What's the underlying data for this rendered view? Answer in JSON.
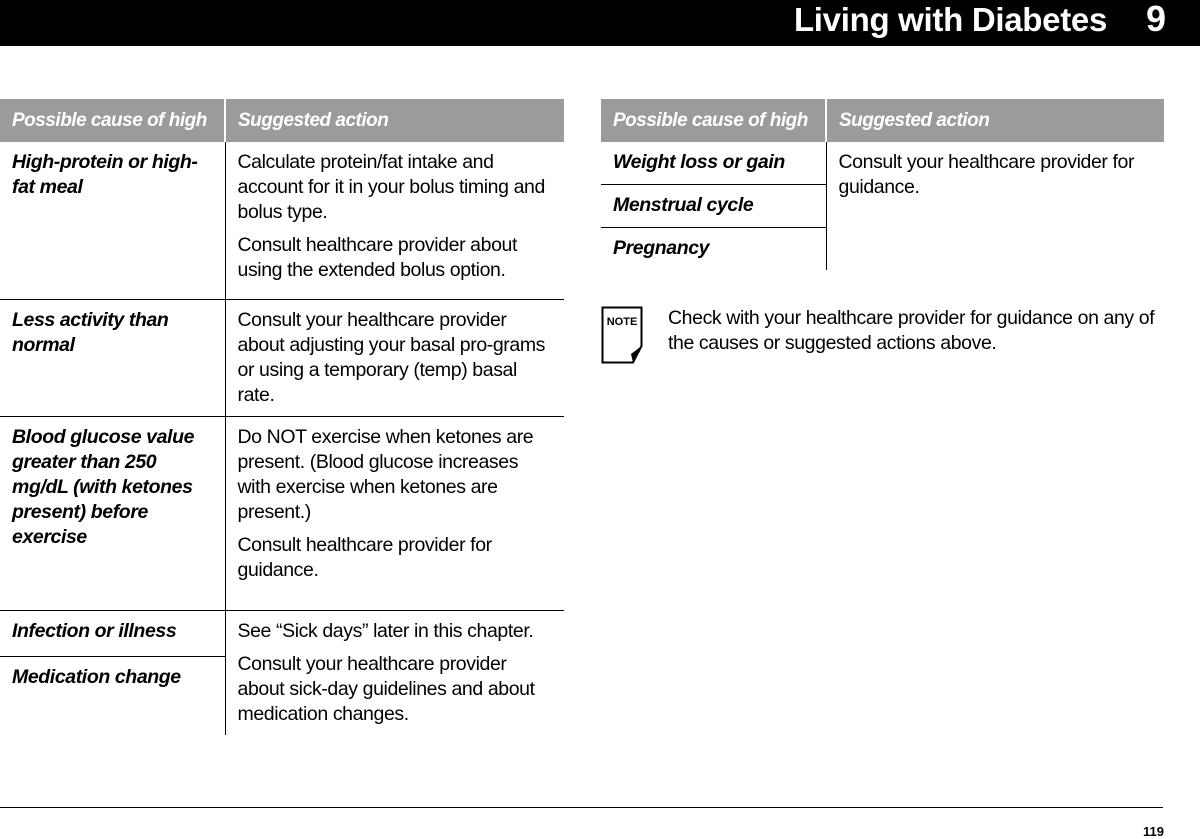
{
  "header": {
    "title": "Living with Diabetes",
    "chapter": "9"
  },
  "table_left": {
    "headers": [
      "Possible cause of high",
      "Suggested action"
    ],
    "rows": [
      {
        "cause": "High-protein or high-fat meal",
        "actions": [
          "Calculate protein/fat intake and account for it in your bolus timing and bolus type.",
          "Consult healthcare provider about using the extended bolus option."
        ]
      },
      {
        "cause": "Less activity than normal",
        "actions": [
          "Consult your healthcare provider about adjusting your basal pro-grams or using a temporary (temp) basal rate."
        ]
      },
      {
        "cause": "Blood glucose value greater than 250 mg/dL (with ketones present) before exercise",
        "actions": [
          "Do NOT exercise when ketones are present. (Blood glucose increases with exercise when ketones are present.)",
          "Consult healthcare provider for guidance."
        ]
      },
      {
        "causes": [
          "Infection or illness",
          "Medication change"
        ],
        "actions": [
          "See “Sick days” later in this chapter.",
          "Consult your healthcare provider about sick-day guidelines and about medication changes."
        ]
      }
    ]
  },
  "table_right": {
    "headers": [
      "Possible cause of high",
      "Suggested action"
    ],
    "causes": [
      "Weight loss or gain",
      "Menstrual cycle",
      "Pregnancy"
    ],
    "action": "Consult your healthcare provider for guidance."
  },
  "note": {
    "icon_label": "NOTE",
    "text": "Check with your healthcare provider for guidance on any of the causes or suggested actions above."
  },
  "footer": {
    "page_number": "119"
  }
}
